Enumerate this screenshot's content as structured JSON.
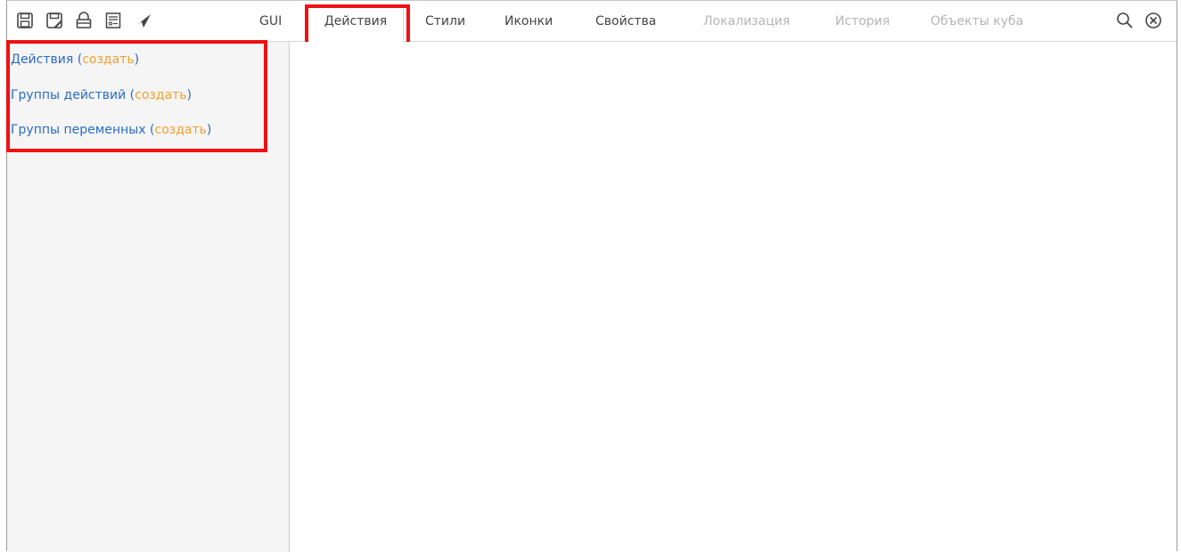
{
  "toolbar": {
    "icons": [
      "save-icon",
      "save-as-icon",
      "lock-icon",
      "form-icon",
      "send-icon"
    ],
    "right_icons": [
      "search-icon",
      "close-circle-icon"
    ]
  },
  "tabs": [
    {
      "label": "GUI",
      "state": "normal"
    },
    {
      "label": "Действия",
      "state": "active"
    },
    {
      "label": "Стили",
      "state": "normal"
    },
    {
      "label": "Иконки",
      "state": "normal"
    },
    {
      "label": "Свойства",
      "state": "normal"
    },
    {
      "label": "Локализация",
      "state": "disabled"
    },
    {
      "label": "История",
      "state": "disabled"
    },
    {
      "label": "Объекты куба",
      "state": "disabled"
    }
  ],
  "sidebar": {
    "items": [
      {
        "label": "Действия",
        "open": " (",
        "create": "создать",
        "close": ")"
      },
      {
        "label": "Группы действий",
        "open": " (",
        "create": "создать",
        "close": ")"
      },
      {
        "label": "Группы переменных",
        "open": " (",
        "create": "создать",
        "close": ")"
      }
    ]
  },
  "colors": {
    "link": "#2b6cc4",
    "create_link": "#f0a030",
    "highlight": "#ee1111",
    "disabled_tab": "#b5b5b5"
  }
}
